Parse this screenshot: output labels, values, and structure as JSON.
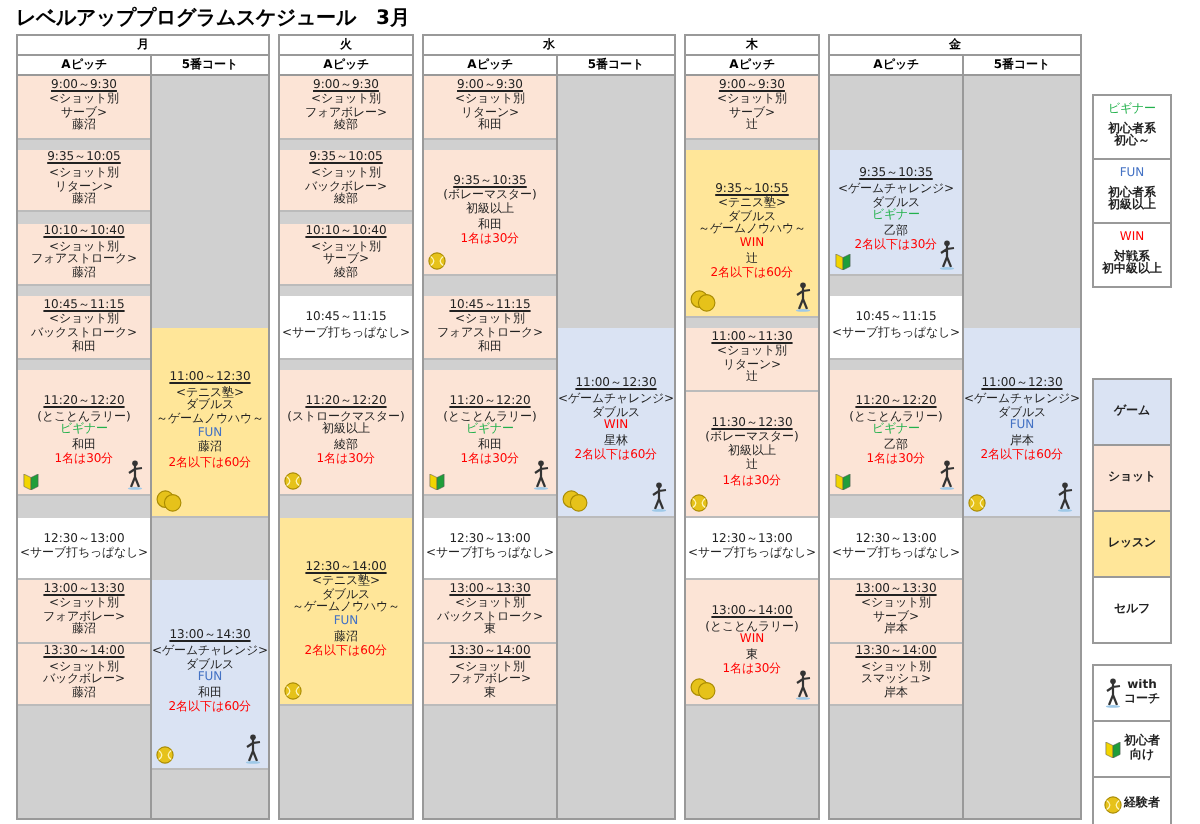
{
  "title": "レベルアッププログラムスケジュール　3月",
  "days": [
    {
      "name": "月",
      "courts": [
        {
          "name": "Aピッチ",
          "entries": [
            {
              "kind": "lesson-half",
              "time": "9:00～9:30",
              "lines": [
                "<ショット別",
                "サーブ>"
              ],
              "coach": "藤沼"
            },
            {
              "kind": "closed-gap"
            },
            {
              "kind": "lesson-half",
              "time": "9:35～10:05",
              "lines": [
                "<ショット別",
                "リターン>"
              ],
              "coach": "藤沼"
            },
            {
              "kind": "closed-gap"
            },
            {
              "kind": "lesson-half",
              "time": "10:10～10:40",
              "lines": [
                "<ショット別",
                "フォアストローク>"
              ],
              "coach": "藤沼"
            },
            {
              "kind": "closed-gap"
            },
            {
              "kind": "lesson-half",
              "time": "10:45～11:15",
              "lines": [
                "<ショット別",
                "バックストローク>"
              ],
              "coach": "和田"
            },
            {
              "kind": "closed-gap"
            },
            {
              "kind": "lesson-hour",
              "time": "11:20～12:20",
              "lines": [
                "(とことんラリー)"
              ],
              "level": {
                "text": "ビギナー",
                "kind": "beginner"
              },
              "coach": "和田",
              "note": "1名は30分",
              "beginner": true,
              "figure": true
            },
            {
              "kind": "closed-break"
            },
            {
              "kind": "free-half",
              "time": "12:30～13:00",
              "lines": [
                "<サーブ打ちっぱなし>"
              ]
            },
            {
              "kind": "lesson-half",
              "time": "13:00～13:30",
              "lines": [
                "<ショット別",
                "フォアボレー>"
              ],
              "coach": "藤沼"
            },
            {
              "kind": "lesson-half",
              "time": "13:30～14:00",
              "lines": [
                "<ショット別",
                "バックボレー>"
              ],
              "coach": "藤沼"
            },
            {
              "kind": "closed-rest"
            }
          ]
        },
        {
          "name": "5番コート",
          "entries": [
            {
              "kind": "closed-morning"
            },
            {
              "kind": "school-ninety",
              "time": "11:00～12:30",
              "lines": [
                "<テニス塾>",
                "ダブルス",
                "～ゲームノウハウ～"
              ],
              "level": {
                "text": "FUN",
                "kind": "fun"
              },
              "coach": "藤沼",
              "note": "2名以下は60分",
              "ball_pair": true
            },
            {
              "kind": "closed-half"
            },
            {
              "kind": "game-ninety",
              "time": "13:00～14:30",
              "lines": [
                "<ゲームチャレンジ>",
                "ダブルス"
              ],
              "level": {
                "text": "FUN",
                "kind": "fun"
              },
              "coach": "和田",
              "note": "2名以下は60分",
              "ball": true,
              "figure": true
            },
            {
              "kind": "closed-rest"
            }
          ]
        }
      ]
    },
    {
      "name": "火",
      "courts": [
        {
          "name": "Aピッチ",
          "entries": [
            {
              "kind": "lesson-half",
              "time": "9:00～9:30",
              "lines": [
                "<ショット別",
                "フォアボレー>"
              ],
              "coach": "綾部"
            },
            {
              "kind": "closed-gap"
            },
            {
              "kind": "lesson-half",
              "time": "9:35～10:05",
              "lines": [
                "<ショット別",
                "バックボレー>"
              ],
              "coach": "綾部"
            },
            {
              "kind": "closed-gap"
            },
            {
              "kind": "lesson-half",
              "time": "10:10～10:40",
              "lines": [
                "<ショット別",
                "サーブ>"
              ],
              "coach": "綾部"
            },
            {
              "kind": "closed-gap"
            },
            {
              "kind": "free-half",
              "time": "10:45～11:15",
              "lines": [
                "<サーブ打ちっぱなし>"
              ]
            },
            {
              "kind": "closed-gap"
            },
            {
              "kind": "lesson-hour",
              "time": "11:20～12:20",
              "lines": [
                "(ストロークマスター)"
              ],
              "req": "初級以上",
              "coach": "綾部",
              "note": "1名は30分",
              "ball": true
            },
            {
              "kind": "closed-break"
            },
            {
              "kind": "school-ninety",
              "time": "12:30～14:00",
              "lines": [
                "<テニス塾>",
                "ダブルス",
                "～ゲームノウハウ～"
              ],
              "level": {
                "text": "FUN",
                "kind": "fun"
              },
              "coach": "藤沼",
              "note": "2名以下は60分",
              "ball": true
            },
            {
              "kind": "closed-rest"
            }
          ]
        }
      ]
    },
    {
      "name": "水",
      "courts": [
        {
          "name": "Aピッチ",
          "entries": [
            {
              "kind": "lesson-half",
              "time": "9:00～9:30",
              "lines": [
                "<ショット別",
                "リターン>"
              ],
              "coach": "和田"
            },
            {
              "kind": "closed-gap"
            },
            {
              "kind": "lesson-hour",
              "time": "9:35～10:35",
              "lines": [
                "(ボレーマスター)"
              ],
              "req": "初級以上",
              "coach": "和田",
              "note": "1名は30分",
              "ball": true
            },
            {
              "kind": "closed-break"
            },
            {
              "kind": "lesson-half",
              "time": "10:45～11:15",
              "lines": [
                "<ショット別",
                "フォアストローク>"
              ],
              "coach": "和田"
            },
            {
              "kind": "closed-gap"
            },
            {
              "kind": "lesson-hour",
              "time": "11:20～12:20",
              "lines": [
                "(とことんラリー)"
              ],
              "level": {
                "text": "ビギナー",
                "kind": "beginner"
              },
              "coach": "和田",
              "note": "1名は30分",
              "beginner": true,
              "figure": true
            },
            {
              "kind": "closed-break"
            },
            {
              "kind": "free-half",
              "time": "12:30～13:00",
              "lines": [
                "<サーブ打ちっぱなし>"
              ]
            },
            {
              "kind": "lesson-half",
              "time": "13:00～13:30",
              "lines": [
                "<ショット別",
                "バックストローク>"
              ],
              "coach": "東"
            },
            {
              "kind": "lesson-half",
              "time": "13:30～14:00",
              "lines": [
                "<ショット別",
                "フォアボレー>"
              ],
              "coach": "東"
            },
            {
              "kind": "closed-rest"
            }
          ]
        },
        {
          "name": "5番コート",
          "entries": [
            {
              "kind": "closed-morning"
            },
            {
              "kind": "game-ninety",
              "time": "11:00～12:30",
              "lines": [
                "<ゲームチャレンジ>",
                "ダブルス"
              ],
              "level": {
                "text": "WIN",
                "kind": "win"
              },
              "coach": "星林",
              "note": "2名以下は60分",
              "ball_pair": true,
              "figure": true
            },
            {
              "kind": "closed-rest"
            }
          ]
        }
      ]
    },
    {
      "name": "木",
      "courts": [
        {
          "name": "Aピッチ",
          "entries": [
            {
              "kind": "lesson-half",
              "time": "9:00～9:30",
              "lines": [
                "<ショット別",
                "サーブ>"
              ],
              "coach": "辻"
            },
            {
              "kind": "closed-gap"
            },
            {
              "kind": "school-extended",
              "time": "9:35～10:55",
              "lines": [
                "<テニス塾>",
                "ダブルス",
                "～ゲームノウハウ～"
              ],
              "level": {
                "text": "WIN",
                "kind": "win"
              },
              "coach": "辻",
              "note": "2名以下は60分",
              "ball_pair": true,
              "figure": true
            },
            {
              "kind": "closed-gap"
            },
            {
              "kind": "lesson-half",
              "time": "11:00～11:30",
              "lines": [
                "<ショット別",
                "リターン>"
              ],
              "coach": "辻"
            },
            {
              "kind": "lesson-hour",
              "time": "11:30～12:30",
              "lines": [
                "(ボレーマスター)"
              ],
              "req": "初級以上",
              "coach": "辻",
              "note": "1名は30分",
              "ball": true
            },
            {
              "kind": "free-half",
              "time": "12:30～13:00",
              "lines": [
                "<サーブ打ちっぱなし>"
              ]
            },
            {
              "kind": "lesson-hour",
              "time": "13:00～14:00",
              "lines": [
                "(とことんラリー)"
              ],
              "level": {
                "text": "WIN",
                "kind": "win"
              },
              "coach": "東",
              "note": "1名は30分",
              "ball_pair": true,
              "figure": true
            },
            {
              "kind": "closed-rest"
            }
          ]
        }
      ]
    },
    {
      "name": "金",
      "courts": [
        {
          "name": "Aピッチ",
          "entries": [
            {
              "kind": "closed-lead"
            },
            {
              "kind": "game-hour",
              "time": "9:35～10:35",
              "lines": [
                "<ゲームチャレンジ>",
                "ダブルス"
              ],
              "level": {
                "text": "ビギナー",
                "kind": "beginner"
              },
              "coach": "乙部",
              "note": "2名以下は30分",
              "beginner": true,
              "figure": true
            },
            {
              "kind": "closed-break"
            },
            {
              "kind": "free-half",
              "time": "10:45～11:15",
              "lines": [
                "<サーブ打ちっぱなし>"
              ]
            },
            {
              "kind": "closed-gap"
            },
            {
              "kind": "lesson-hour",
              "time": "11:20～12:20",
              "lines": [
                "(とことんラリー)"
              ],
              "level": {
                "text": "ビギナー",
                "kind": "beginner"
              },
              "coach": "乙部",
              "note": "1名は30分",
              "beginner": true,
              "figure": true
            },
            {
              "kind": "closed-break"
            },
            {
              "kind": "free-half",
              "time": "12:30～13:00",
              "lines": [
                "<サーブ打ちっぱなし>"
              ]
            },
            {
              "kind": "lesson-half",
              "time": "13:00～13:30",
              "lines": [
                "<ショット別",
                "サーブ>"
              ],
              "coach": "岸本"
            },
            {
              "kind": "lesson-half",
              "time": "13:30～14:00",
              "lines": [
                "<ショット別",
                "スマッシュ>"
              ],
              "coach": "岸本"
            },
            {
              "kind": "closed-rest"
            }
          ]
        },
        {
          "name": "5番コート",
          "entries": [
            {
              "kind": "closed-morning"
            },
            {
              "kind": "game-ninety",
              "time": "11:00～12:30",
              "lines": [
                "<ゲームチャレンジ>",
                "ダブルス"
              ],
              "level": {
                "text": "FUN",
                "kind": "fun"
              },
              "coach": "岸本",
              "note": "2名以下は60分",
              "ball": true,
              "figure": true
            },
            {
              "kind": "closed-rest"
            }
          ]
        }
      ]
    }
  ],
  "legend_levels": [
    {
      "tag": "ビギナー",
      "kind": "beginner",
      "description": [
        "初心者系",
        "初心～"
      ]
    },
    {
      "tag": "FUN",
      "kind": "fun",
      "description": [
        "初心者系",
        "初級以上"
      ]
    },
    {
      "tag": "WIN",
      "kind": "win",
      "description": [
        "対戦系",
        "初中級以上"
      ]
    }
  ],
  "legend_types": [
    {
      "label": "ゲーム",
      "kind": "game"
    },
    {
      "label": "ショット",
      "kind": "lesson"
    },
    {
      "label": "レッスン",
      "kind": "school"
    },
    {
      "label": "セルフ",
      "kind": "free"
    }
  ],
  "legend_icons": [
    {
      "kind": "figure",
      "labels": [
        "with",
        "コーチ"
      ]
    },
    {
      "kind": "beginner",
      "labels": [
        "初心者",
        "向け"
      ]
    },
    {
      "kind": "ball",
      "labels": [
        "経験者"
      ]
    }
  ]
}
